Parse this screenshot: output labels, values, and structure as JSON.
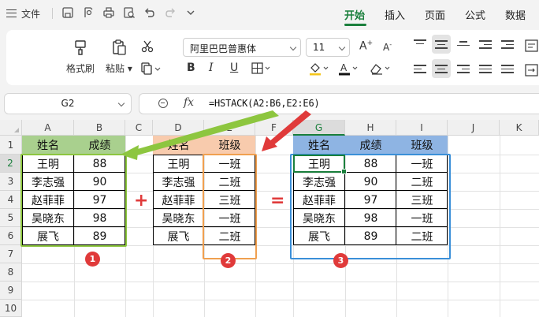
{
  "menu": {
    "file_label": "文件",
    "tabs": [
      {
        "label": "开始",
        "active": true
      },
      {
        "label": "插入",
        "active": false
      },
      {
        "label": "页面",
        "active": false
      },
      {
        "label": "公式",
        "active": false
      },
      {
        "label": "数据",
        "active": false
      }
    ]
  },
  "ribbon": {
    "format_painter": "格式刷",
    "paste": "粘贴",
    "font_name": "阿里巴巴普惠体",
    "font_size": "11"
  },
  "formula_bar": {
    "name_box": "G2",
    "fx_label": "fx",
    "formula": "=HSTACK(A2:B6,E2:E6)"
  },
  "grid": {
    "columns": [
      "A",
      "B",
      "C",
      "D",
      "E",
      "F",
      "G",
      "H",
      "I",
      "J",
      "K"
    ],
    "rows": [
      "1",
      "2",
      "3",
      "4",
      "5",
      "6",
      "7",
      "8",
      "9",
      "10"
    ],
    "selected_column": "G",
    "selected_row": "2"
  },
  "table1": {
    "headers": [
      "姓名",
      "成绩"
    ],
    "rows": [
      [
        "王明",
        "88"
      ],
      [
        "李志强",
        "90"
      ],
      [
        "赵菲菲",
        "97"
      ],
      [
        "吴晓东",
        "98"
      ],
      [
        "展飞",
        "89"
      ]
    ]
  },
  "table2": {
    "headers": [
      "姓名",
      "班级"
    ],
    "rows": [
      [
        "王明",
        "一班"
      ],
      [
        "李志强",
        "二班"
      ],
      [
        "赵菲菲",
        "三班"
      ],
      [
        "吴晓东",
        "一班"
      ],
      [
        "展飞",
        "二班"
      ]
    ]
  },
  "table3": {
    "headers": [
      "姓名",
      "成绩",
      "班级"
    ],
    "rows": [
      [
        "王明",
        "88",
        "一班"
      ],
      [
        "李志强",
        "90",
        "二班"
      ],
      [
        "赵菲菲",
        "97",
        "三班"
      ],
      [
        "吴晓东",
        "98",
        "一班"
      ],
      [
        "展飞",
        "89",
        "二班"
      ]
    ]
  },
  "annotations": {
    "plus": "+",
    "equals": "=",
    "badge1": "1",
    "badge2": "2",
    "badge3": "3"
  },
  "colors": {
    "accent": "#1a7f3c",
    "green_header": "#a9d08e",
    "orange_header": "#f8cbad",
    "blue_header": "#8eb4e3",
    "green_outline": "#8dc63f",
    "orange_outline": "#f0a050",
    "blue_outline": "#3a8fd8",
    "red": "#e03a3a"
  }
}
